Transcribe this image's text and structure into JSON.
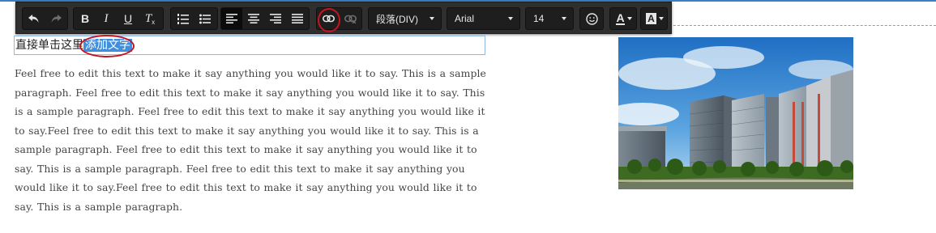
{
  "toolbar": {
    "buttons": [
      {
        "name": "undo",
        "icon": "undo-icon"
      },
      {
        "name": "redo",
        "icon": "redo-icon"
      },
      {
        "name": "bold",
        "label": "B"
      },
      {
        "name": "italic",
        "label": "I"
      },
      {
        "name": "underline",
        "label": "U"
      },
      {
        "name": "clear-format",
        "label": "T"
      },
      {
        "name": "ordered-list",
        "icon": "ordered-list-icon"
      },
      {
        "name": "unordered-list",
        "icon": "unordered-list-icon"
      },
      {
        "name": "align-left",
        "icon": "align-left-icon",
        "active": true
      },
      {
        "name": "align-center",
        "icon": "align-center-icon"
      },
      {
        "name": "align-right",
        "icon": "align-right-icon"
      },
      {
        "name": "align-justify",
        "icon": "align-justify-icon"
      },
      {
        "name": "insert-link",
        "icon": "link-icon",
        "highlighted": true
      },
      {
        "name": "remove-link",
        "icon": "unlink-icon",
        "disabled": true
      },
      {
        "name": "emoticon",
        "icon": "smiley-icon"
      },
      {
        "name": "font-color",
        "label": "A"
      },
      {
        "name": "background-color",
        "label": "A"
      }
    ],
    "paragraph_format": "段落(DIV)",
    "font_family": "Arial",
    "font_size": "14",
    "colors": {
      "bar": "#2f2f2f",
      "group": "#1e1e1e",
      "annotation": "#c8141e"
    }
  },
  "editor": {
    "headline_prefix": "直接单击这里",
    "headline_selected": "添加文字",
    "paragraph": "Feel free to edit this text to make it say anything you would like it to say.  This is a sample paragraph.  Feel free to edit this text to make it say anything you would like it to say.  This is a sample paragraph.  Feel free to edit this text to make it say anything you would like it to say.Feel free to edit this text to make it say anything you would like it to say.  This is a sample paragraph.  Feel free to edit this text to make it say anything you would like it to say.  This is a sample paragraph.  Feel free to edit this text to make it say anything you would like it to say.Feel free to edit this text to make it say anything you would like it to say.  This is a sample paragraph.",
    "selection_color": "#3f8fdd"
  },
  "image": {
    "subject": "campus-buildings-photo"
  }
}
